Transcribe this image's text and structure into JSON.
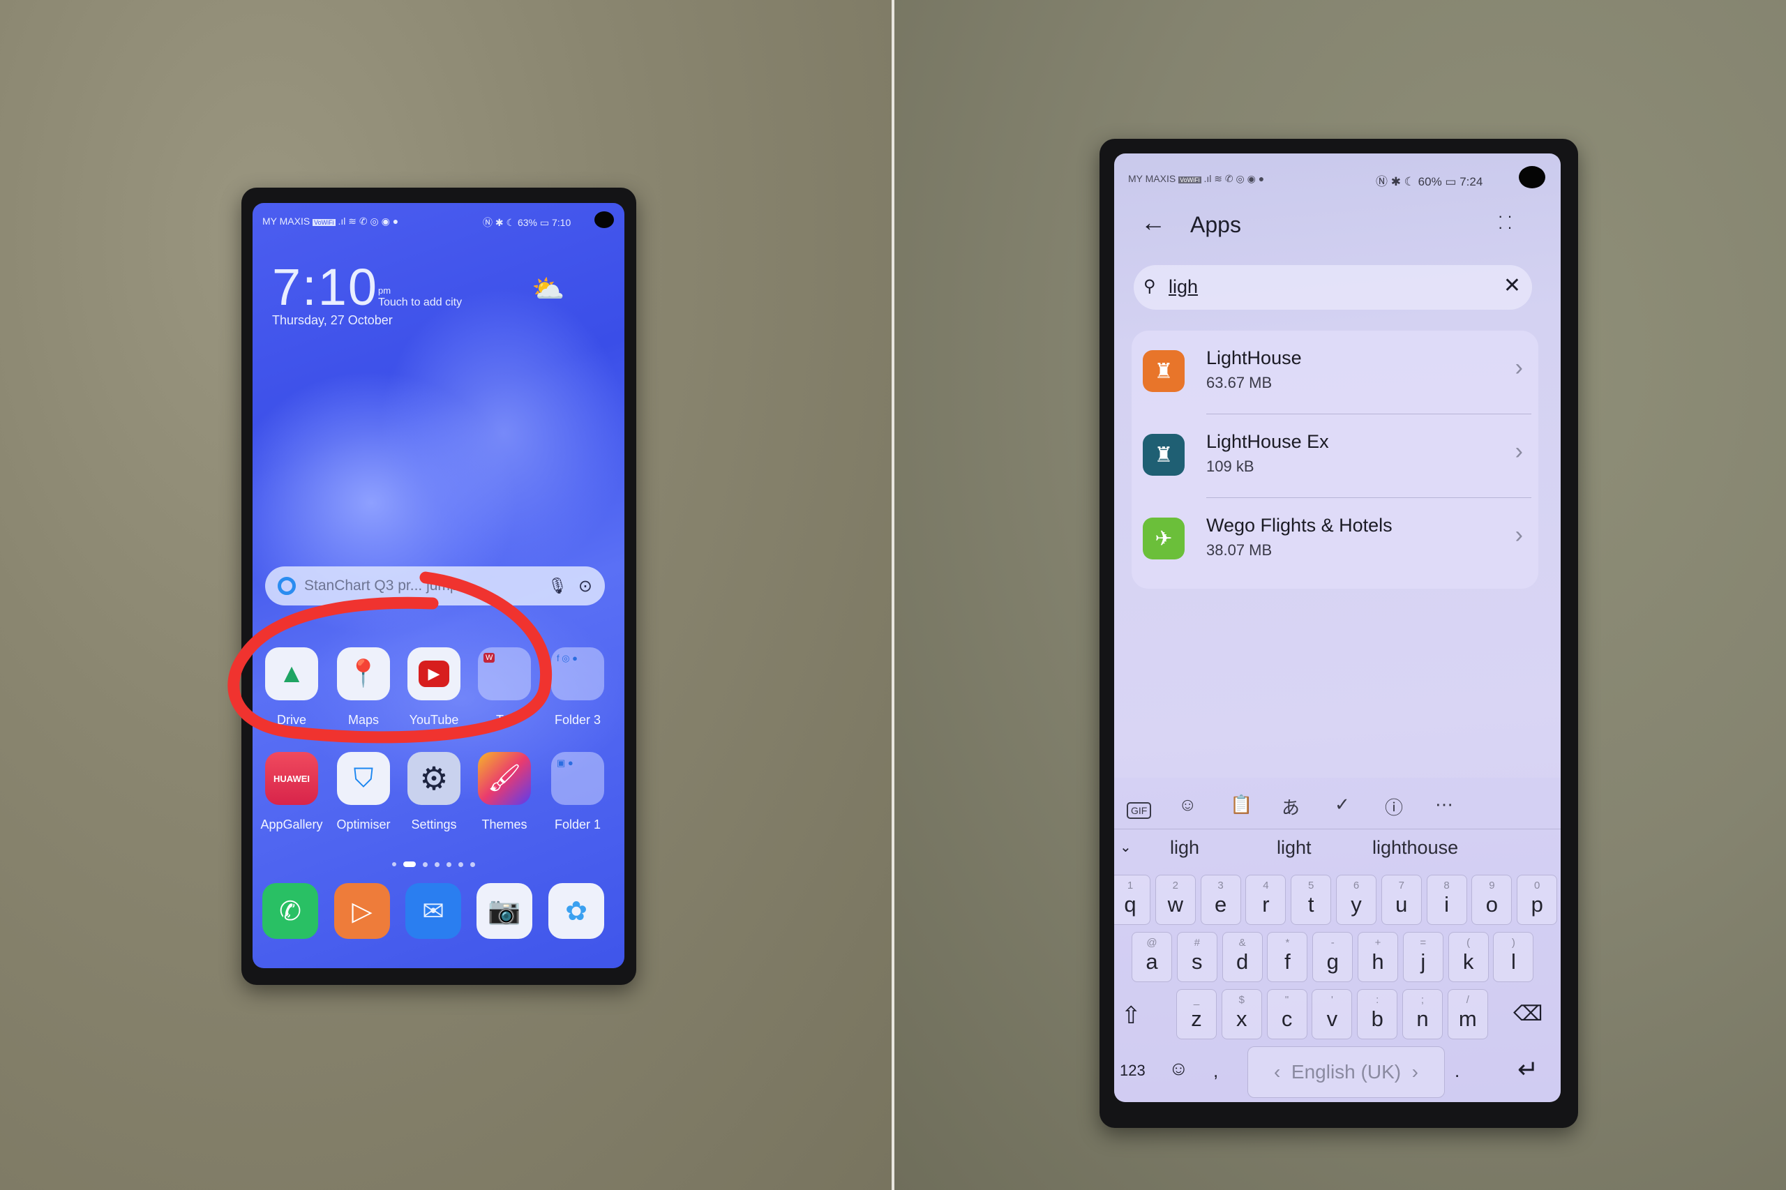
{
  "left_phone": {
    "status_bar": {
      "carrier": "MY MAXIS",
      "carrier_badge": "VoWiFi",
      "right": "63%",
      "time": "7:10"
    },
    "clock": {
      "time": "7:10",
      "ampm": "pm",
      "weather_hint": "Touch to add city",
      "date": "Thursday, 27 October"
    },
    "search": {
      "placeholder": "StanChart Q3 pr... jumps..."
    },
    "row1": [
      {
        "label": "Drive",
        "icon": "google-drive-icon"
      },
      {
        "label": "Maps",
        "icon": "google-maps-icon"
      },
      {
        "label": "YouTube",
        "icon": "youtube-icon"
      },
      {
        "label": "T...",
        "icon": "folder-icon"
      },
      {
        "label": "Folder 3",
        "icon": "folder-icon"
      }
    ],
    "row2": [
      {
        "label": "AppGallery",
        "icon": "appgallery-icon",
        "badge_text": "HUAWEI"
      },
      {
        "label": "Optimiser",
        "icon": "shield-icon"
      },
      {
        "label": "Settings",
        "icon": "gear-icon"
      },
      {
        "label": "Themes",
        "icon": "paintbrush-icon"
      },
      {
        "label": "Folder 1",
        "icon": "folder-icon"
      }
    ],
    "dock": [
      "phone-icon",
      "video-icon",
      "messages-icon",
      "camera-icon",
      "gallery-icon"
    ],
    "annotation_color": "#f0332f"
  },
  "right_phone": {
    "status_bar": {
      "carrier": "MY MAXIS",
      "carrier_badge": "VoWiFi",
      "right": "60%",
      "time": "7:24"
    },
    "header": {
      "title": "Apps"
    },
    "search": {
      "value": "ligh"
    },
    "results": [
      {
        "name": "LightHouse",
        "size": "63.67 MB",
        "color": "#e8752a"
      },
      {
        "name": "LightHouse Ex",
        "size": "109 kB",
        "color": "#1f5f73"
      },
      {
        "name": "Wego Flights & Hotels",
        "size": "38.07 MB",
        "color": "#6bbf3a"
      }
    ],
    "keyboard": {
      "toolbar": [
        "GIF",
        "sticker-icon",
        "clipboard-icon",
        "translate-icon",
        "check-icon",
        "info-icon",
        "more-icon"
      ],
      "suggestions": [
        "ligh",
        "light",
        "lighthouse"
      ],
      "row1": [
        [
          "1",
          "q"
        ],
        [
          "2",
          "w"
        ],
        [
          "3",
          "e"
        ],
        [
          "4",
          "r"
        ],
        [
          "5",
          "t"
        ],
        [
          "6",
          "y"
        ],
        [
          "7",
          "u"
        ],
        [
          "8",
          "i"
        ],
        [
          "9",
          "o"
        ],
        [
          "0",
          "p"
        ]
      ],
      "row2": [
        [
          "@",
          "a"
        ],
        [
          "#",
          "s"
        ],
        [
          "&",
          "d"
        ],
        [
          "*",
          "f"
        ],
        [
          "-",
          "g"
        ],
        [
          "+",
          "h"
        ],
        [
          "=",
          "j"
        ],
        [
          "(",
          "k"
        ],
        [
          ")",
          "l"
        ]
      ],
      "row3": [
        [
          "_",
          "z"
        ],
        [
          "$",
          "x"
        ],
        [
          "\"",
          "c"
        ],
        [
          "'",
          "v"
        ],
        [
          ":",
          "b"
        ],
        [
          ";",
          "n"
        ],
        [
          "/",
          "m"
        ]
      ],
      "numbers_label": "123",
      "space_label": "English (UK)"
    }
  }
}
